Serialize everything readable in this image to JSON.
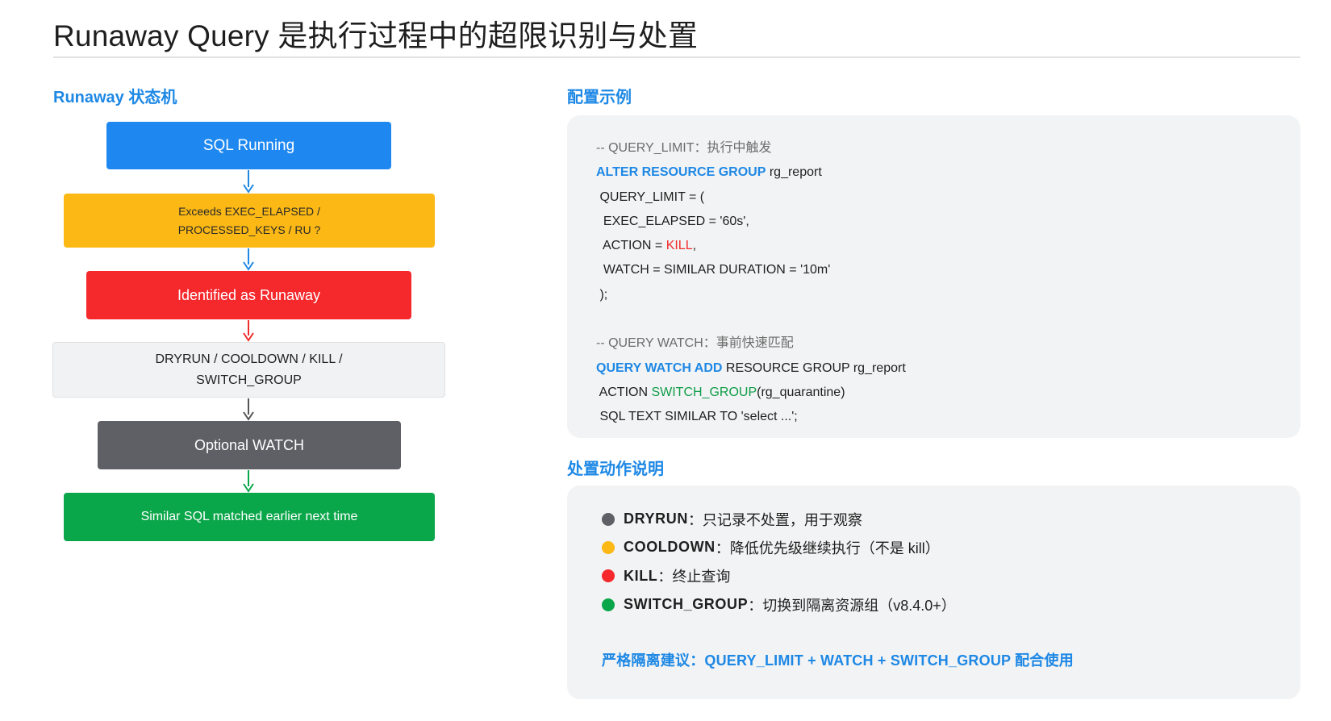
{
  "title": "Runaway Query 是执行过程中的超限识别与处置",
  "left_section": {
    "heading": "Runaway 状态机",
    "nodes": {
      "sql_running": "SQL Running",
      "exceeds_line1": "Exceeds EXEC_ELAPSED /",
      "exceeds_line2": "PROCESSED_KEYS / RU ?",
      "identified": "Identified as Runaway",
      "actions_line1": "DRYRUN / COOLDOWN / KILL /",
      "actions_line2": "SWITCH_GROUP",
      "optional_watch": "Optional WATCH",
      "similar_sql": "Similar SQL matched earlier next time"
    },
    "arrow_colors": [
      "#1e88e5",
      "#1e88e5",
      "#f02b2b",
      "#555555",
      "#0aa64a"
    ]
  },
  "config_section": {
    "heading": "配置示例",
    "lines": [
      {
        "parts": [
          {
            "cls": "cmt",
            "text": "-- QUERY_LIMIT：执行中触发"
          }
        ]
      },
      {
        "parts": [
          {
            "cls": "kw",
            "text": "ALTER RESOURCE GROUP"
          },
          {
            "cls": "",
            "text": " rg_report"
          }
        ]
      },
      {
        "parts": [
          {
            "cls": "",
            "text": " QUERY_LIMIT = ("
          }
        ]
      },
      {
        "parts": [
          {
            "cls": "",
            "text": "  EXEC_ELAPSED = '60s',"
          }
        ]
      },
      {
        "parts": [
          {
            "cls": "",
            "text": "  ACTION = "
          },
          {
            "cls": "red",
            "text": "KILL"
          },
          {
            "cls": "",
            "text": ","
          }
        ]
      },
      {
        "parts": [
          {
            "cls": "",
            "text": "  WATCH = SIMILAR DURATION = '10m'"
          }
        ]
      },
      {
        "parts": [
          {
            "cls": "",
            "text": " );"
          }
        ]
      },
      {
        "parts": [
          {
            "cls": "",
            "text": ""
          }
        ]
      },
      {
        "parts": [
          {
            "cls": "cmt",
            "text": "-- QUERY WATCH：事前快速匹配"
          }
        ]
      },
      {
        "parts": [
          {
            "cls": "kw",
            "text": "QUERY WATCH ADD"
          },
          {
            "cls": "",
            "text": " RESOURCE GROUP rg_report"
          }
        ]
      },
      {
        "parts": [
          {
            "cls": "",
            "text": " ACTION "
          },
          {
            "cls": "grn",
            "text": "SWITCH_GROUP"
          },
          {
            "cls": "",
            "text": "(rg_quarantine)"
          }
        ]
      },
      {
        "parts": [
          {
            "cls": "",
            "text": " SQL TEXT SIMILAR TO 'select ...';"
          }
        ]
      }
    ]
  },
  "actions_section": {
    "heading": "处置动作说明",
    "items": [
      {
        "name": "DRYRUN",
        "desc": "：只记录不处置，用于观察",
        "color": "#5f6066"
      },
      {
        "name": "COOLDOWN",
        "desc": "：降低优先级继续执行（不是 kill）",
        "color": "#fcb814"
      },
      {
        "name": "KILL",
        "desc": "：终止查询",
        "color": "#f5282c"
      },
      {
        "name": "SWITCH_GROUP",
        "desc": "：切换到隔离资源组（v8.4.0+）",
        "color": "#0aa64a"
      }
    ],
    "recommendation": "严格隔离建议：QUERY_LIMIT + WATCH + SWITCH_GROUP 配合使用"
  }
}
